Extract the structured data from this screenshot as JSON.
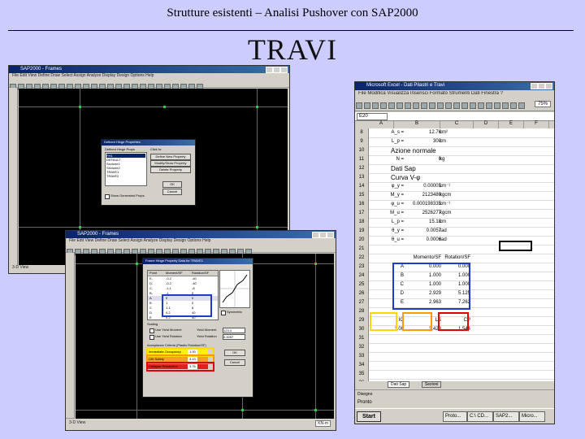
{
  "slide": {
    "header": "Strutture esistenti – Analisi Pushover con SAP2000",
    "title": "TRAVI"
  },
  "sap_window_1": {
    "title": "SAP2000 - Frames",
    "menu": "File Edit View Define Draw Select Assign Analyze Display Design Options Help",
    "dialog_title": "Defined Hinge Properties",
    "dialog_list_label": "Defined Hinge Props",
    "dialog_list": [
      "FH1",
      "DEFAULT",
      "Sezione1",
      "Sezione2",
      "TRAVE1",
      "TRAVE2"
    ],
    "dialog_click_label": "Click to:",
    "dialog_buttons": [
      "Define New Property",
      "Modify/Show Property",
      "Delete Property"
    ],
    "ok": "OK",
    "cancel": "Cancel",
    "checkbox": "Show Generated Props",
    "status": "3-D View"
  },
  "sap_window_2": {
    "title": "SAP2000 - Frames",
    "menu": "File Edit View Define Draw Select Assign Analyze Display Design Options Help",
    "dialog_title": "Frame Hinge Property Data for TRAVE1",
    "table_headers": [
      "Point",
      "Moment/SF",
      "Rotation/SF"
    ],
    "table_rows": [
      [
        "E-",
        "-0.2",
        "-40"
      ],
      [
        "D-",
        "-0.2",
        "-40"
      ],
      [
        "C-",
        "-1.1",
        "-8"
      ],
      [
        "B-",
        "-1",
        "0"
      ],
      [
        "A",
        "0",
        "0"
      ],
      [
        "B",
        "1",
        "0"
      ],
      [
        "C",
        "1.1",
        "8"
      ],
      [
        "D",
        "0.2",
        "40"
      ],
      [
        "E",
        "0.2",
        "40"
      ]
    ],
    "symmetric": "Symmetric",
    "scaling_label": "Scaling",
    "use_yield_moment": "Use Yield Moment",
    "use_yield_rotation": "Use Yield Rotation",
    "yield_moment_label": "Yield Moment",
    "yield_rotation_label": "Yield Rotation",
    "yield_moment_value": "123.4",
    "yield_rotation_value": "0.0057",
    "acceptance_title": "Acceptance Criteria (Plastic Rotation/SF)",
    "acceptance": [
      {
        "label": "Immediate Occupancy",
        "value": "1.00"
      },
      {
        "label": "Life Safety",
        "value": "3.43"
      },
      {
        "label": "Collapse Prevention",
        "value": "3.76"
      }
    ],
    "ok": "OK",
    "cancel": "Cancel",
    "status": "3-D View",
    "units": "KN-m"
  },
  "excel": {
    "title": "Microsoft Excel - Dati Pilastri e Travi",
    "menu": "File Modifica Visualizza Inserisci Formato Strumenti Dati Finestra ?",
    "zoom": "75%",
    "name_box": "E20",
    "columns": [
      "A",
      "B",
      "C",
      "D",
      "E",
      "F"
    ],
    "rows": [
      {
        "n": "8",
        "a": "A_s =",
        "b": "12.76",
        "c": "cm²"
      },
      {
        "n": "9",
        "a": "L_p =",
        "b": "300",
        "c": "cm"
      },
      {
        "n": "10",
        "big": "Azione normale"
      },
      {
        "n": "11",
        "a": "N =",
        "b": "0",
        "c": "kg"
      },
      {
        "n": "12",
        "big": "Dati Sap"
      },
      {
        "n": "13",
        "big": "Curva V-φ"
      },
      {
        "n": "14",
        "a": "φ_y =",
        "b": "0.00005",
        "c": "cm⁻¹"
      },
      {
        "n": "15",
        "a": "M_y =",
        "b": "2123480",
        "c": "kgcm"
      },
      {
        "n": "16",
        "a": "φ_u =",
        "b": "0.000198335",
        "c": "cm⁻¹"
      },
      {
        "n": "17",
        "a": "M_u =",
        "b": "2526277",
        "c": "kgcm"
      },
      {
        "n": "18",
        "a": "L_p =",
        "b": "15.18",
        "c": "cm"
      },
      {
        "n": "19",
        "a": "θ_y =",
        "b": "0.0057",
        "c": "rad"
      },
      {
        "n": "20",
        "a": "θ_u =",
        "b": "0.0006",
        "c": "rad"
      },
      {
        "n": "21"
      },
      {
        "n": "22",
        "b": "Momento/SF",
        "d": "Rotation/SF"
      },
      {
        "n": "23",
        "a": "A",
        "b": "0.000",
        "d": "0.000"
      },
      {
        "n": "24",
        "a": "B",
        "b": "1.000",
        "d": "1.000"
      },
      {
        "n": "25",
        "a": "C",
        "b": "1.000",
        "d": "1.000"
      },
      {
        "n": "26",
        "a": "D",
        "b": "2.929",
        "d": "5.125"
      },
      {
        "n": "27",
        "a": "E",
        "b": "2.963",
        "d": "7.262"
      },
      {
        "n": "28"
      },
      {
        "n": "29",
        "a": "IO",
        "b": "LS",
        "d": "CP"
      },
      {
        "n": "30",
        "a": "1.00",
        "b": "3.428",
        "d": "1.544"
      },
      {
        "n": "31"
      },
      {
        "n": "32"
      },
      {
        "n": "33"
      },
      {
        "n": "34"
      },
      {
        "n": "35"
      },
      {
        "n": "36"
      },
      {
        "n": "37"
      },
      {
        "n": "38"
      },
      {
        "n": "39"
      },
      {
        "n": "40"
      }
    ],
    "sheet_tabs": [
      "Dati Sap",
      "Sezioni"
    ],
    "draw_label": "Disegno",
    "status": "Pronto",
    "start": "Start",
    "taskbar": [
      "Proto...",
      "C:\\ CD...",
      "SAP2...",
      "Micro..."
    ]
  }
}
